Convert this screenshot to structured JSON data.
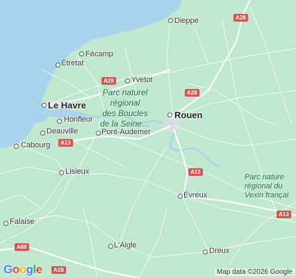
{
  "map": {
    "colors": {
      "sea": "#a9d3ec",
      "land": "#bfe8cf",
      "road": "#ffffff",
      "motorway_shield": "#d9534f"
    },
    "cities": [
      {
        "id": "le-havre",
        "name": "Le Havre"
      },
      {
        "id": "rouen",
        "name": "Rouen"
      }
    ],
    "towns": [
      {
        "id": "dieppe",
        "name": "Dieppe"
      },
      {
        "id": "fecamp",
        "name": "Fécamp"
      },
      {
        "id": "etretat",
        "name": "Étretat"
      },
      {
        "id": "yvetot",
        "name": "Yvetot"
      },
      {
        "id": "honfleur",
        "name": "Honfleur"
      },
      {
        "id": "deauville",
        "name": "Deauville"
      },
      {
        "id": "pont-audemer",
        "name": "Pont-Audemer"
      },
      {
        "id": "cabourg",
        "name": "Cabourg"
      },
      {
        "id": "lisieux",
        "name": "Lisieux"
      },
      {
        "id": "evreux",
        "name": "Évreux"
      },
      {
        "id": "falaise",
        "name": "Falaise"
      },
      {
        "id": "laigle",
        "name": "L'Aigle"
      },
      {
        "id": "dreux",
        "name": "Dreux"
      }
    ],
    "parks": [
      {
        "id": "boucles",
        "lines": [
          "Parc naturel",
          "régional",
          "des Boucles",
          "de la Seine…"
        ]
      },
      {
        "id": "vexin",
        "lines": [
          "Parc nature",
          "régional du",
          "Vexin françai"
        ]
      }
    ],
    "road_shields": [
      "A28",
      "A29",
      "A28",
      "A13",
      "A13",
      "A13",
      "A88",
      "A28"
    ]
  },
  "logo": "Google",
  "attribution": "Map data ©2026 Google"
}
